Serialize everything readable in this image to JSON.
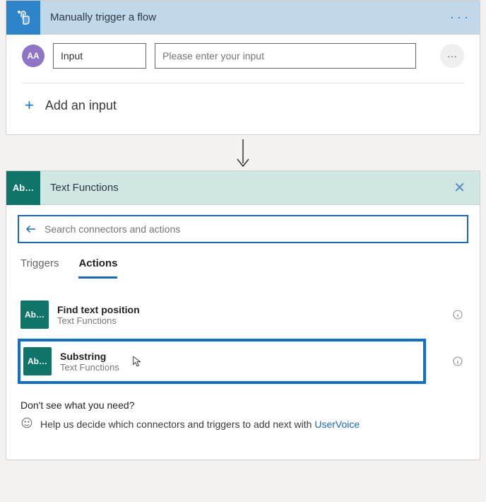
{
  "trigger": {
    "title": "Manually trigger a flow",
    "icon": "touch-icon",
    "menu_label": "···",
    "input": {
      "param_icon": "AA",
      "name_value": "Input",
      "value_placeholder": "Please enter your input",
      "value_value": "",
      "row_menu_label": "···"
    },
    "add_input_label": "Add an input",
    "add_plus": "+"
  },
  "picker": {
    "icon_label": "Ab…",
    "title": "Text Functions",
    "close_glyph": "✕",
    "search": {
      "placeholder": "Search connectors and actions",
      "value": ""
    },
    "tabs": {
      "triggers": "Triggers",
      "actions": "Actions",
      "active": "actions"
    },
    "actions": [
      {
        "name": "Find text position",
        "connector": "Text Functions",
        "tile": "Ab…",
        "selected": false
      },
      {
        "name": "Substring",
        "connector": "Text Functions",
        "tile": "Ab…",
        "selected": true
      }
    ],
    "footer": {
      "question": "Don't see what you need?",
      "help_prefix": "Help us decide which connectors and triggers to add next with ",
      "help_link": "UserVoice"
    }
  }
}
